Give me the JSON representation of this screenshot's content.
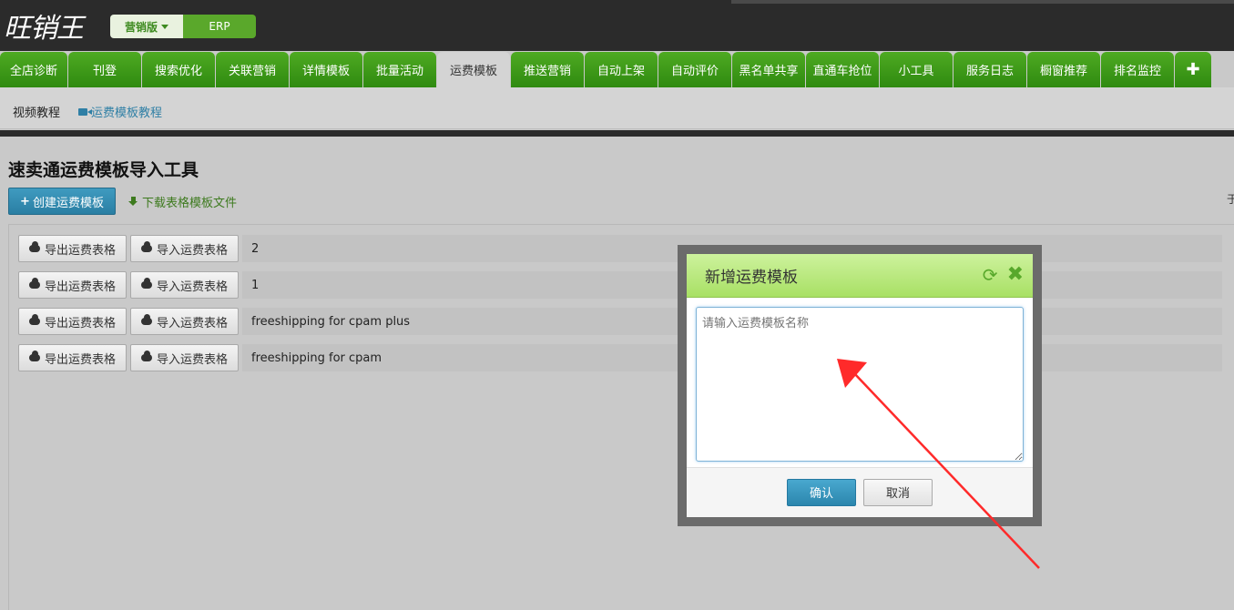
{
  "topbar": {
    "logo_text": "旺销王",
    "version_selected": "营销版",
    "version_other": "ERP"
  },
  "tabs": [
    {
      "label": "全店诊断",
      "width": 74
    },
    {
      "label": "刊登",
      "width": 80
    },
    {
      "label": "搜索优化",
      "width": 80
    },
    {
      "label": "关联营销",
      "width": 80
    },
    {
      "label": "详情模板",
      "width": 80
    },
    {
      "label": "批量活动",
      "width": 80
    },
    {
      "label": "运费模板",
      "width": 80,
      "active": true
    },
    {
      "label": "推送营销",
      "width": 80
    },
    {
      "label": "自动上架",
      "width": 80
    },
    {
      "label": "自动评价",
      "width": 80
    },
    {
      "label": "黑名单共享",
      "width": 80
    },
    {
      "label": "直通车抢位",
      "width": 80
    },
    {
      "label": "小工具",
      "width": 80
    },
    {
      "label": "服务日志",
      "width": 80
    },
    {
      "label": "橱窗推荐",
      "width": 80
    },
    {
      "label": "排名监控",
      "width": 80
    }
  ],
  "tab_plus": "✚",
  "subnav": {
    "video_tutorial": "视频教程",
    "template_tutorial": "运费模板教程"
  },
  "main": {
    "title": "速卖通运费模板导入工具",
    "create_button": "创建运费模板",
    "download_link": "下载表格模板文件",
    "right_glyph": "于"
  },
  "rows": [
    {
      "export": "导出运费表格",
      "import": "导入运费表格",
      "name": "2"
    },
    {
      "export": "导出运费表格",
      "import": "导入运费表格",
      "name": "1"
    },
    {
      "export": "导出运费表格",
      "import": "导入运费表格",
      "name": "freeshipping for cpam plus"
    },
    {
      "export": "导出运费表格",
      "import": "导入运费表格",
      "name": "freeshipping for cpam"
    }
  ],
  "modal": {
    "title": "新增运费模板",
    "placeholder": "请输入运费模板名称",
    "value": "",
    "confirm": "确认",
    "cancel": "取消"
  },
  "colors": {
    "tab_green": "#3a9a18",
    "accent_blue": "#2a7fa3",
    "annotation_red": "#ff2a2a"
  }
}
